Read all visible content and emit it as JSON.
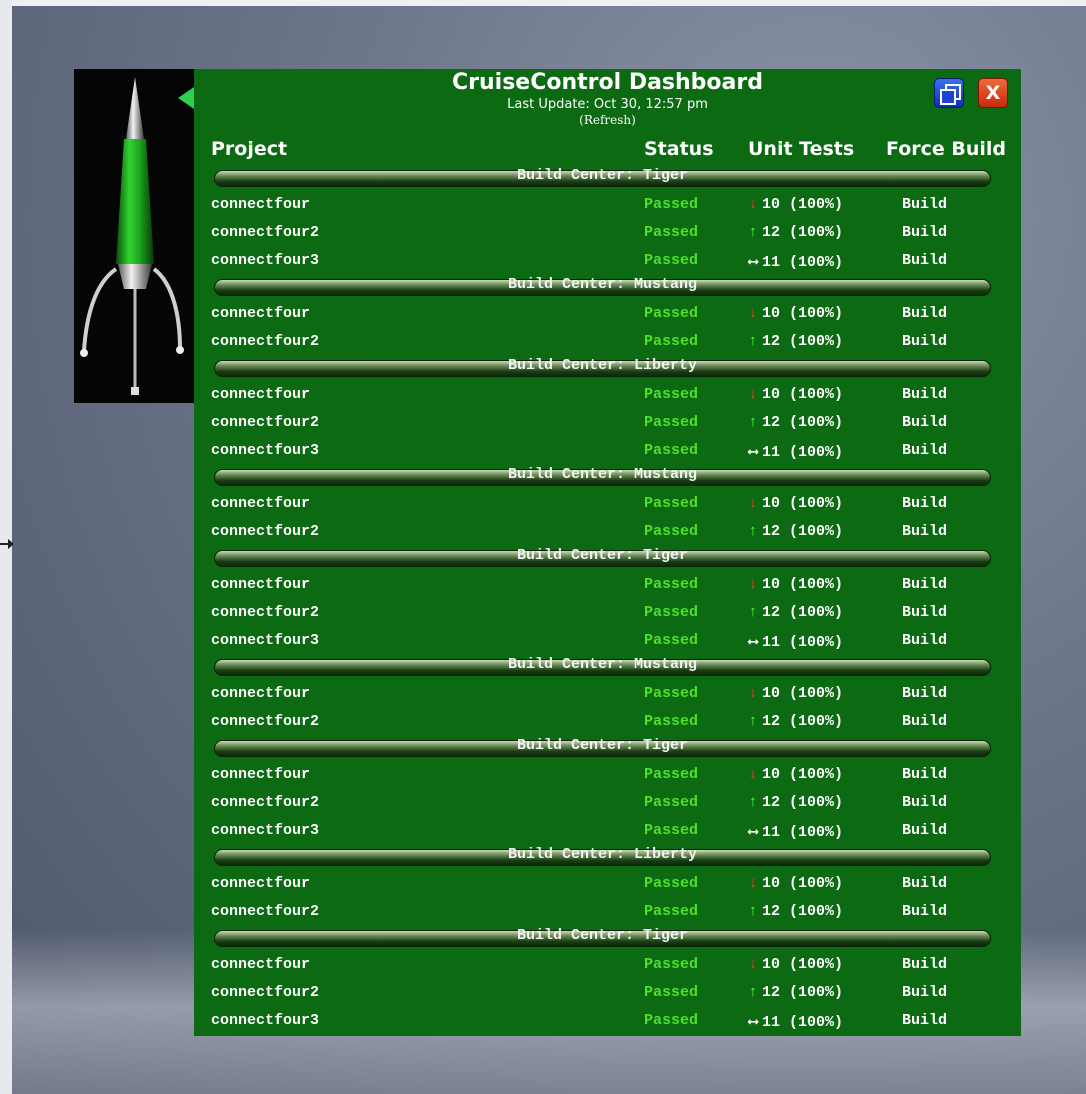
{
  "dashboard": {
    "title": "CruiseControl Dashboard",
    "last_update": "Last Update: Oct 30, 12:57 pm",
    "refresh": "(Refresh)",
    "close_label": "X",
    "headers": {
      "project": "Project",
      "status": "Status",
      "unit_tests": "Unit Tests",
      "force_build": "Force Build"
    },
    "colors": {
      "panel": "#0b6a12",
      "passed": "#4fe02a",
      "down": "#ff3a24",
      "up": "#49ff3a"
    }
  },
  "groups": [
    {
      "name": "Build Center: Tiger",
      "rows": [
        {
          "project": "connectfour",
          "status": "Passed",
          "trend": "down",
          "tests": "10 (100%)",
          "build": "Build"
        },
        {
          "project": "connectfour2",
          "status": "Passed",
          "trend": "up",
          "tests": "12 (100%)",
          "build": "Build"
        },
        {
          "project": "connectfour3",
          "status": "Passed",
          "trend": "flat",
          "tests": "11 (100%)",
          "build": "Build"
        }
      ]
    },
    {
      "name": "Build Center: Mustang",
      "rows": [
        {
          "project": "connectfour",
          "status": "Passed",
          "trend": "down",
          "tests": "10 (100%)",
          "build": "Build"
        },
        {
          "project": "connectfour2",
          "status": "Passed",
          "trend": "up",
          "tests": "12 (100%)",
          "build": "Build"
        }
      ]
    },
    {
      "name": "Build Center: Liberty",
      "rows": [
        {
          "project": "connectfour",
          "status": "Passed",
          "trend": "down",
          "tests": "10 (100%)",
          "build": "Build"
        },
        {
          "project": "connectfour2",
          "status": "Passed",
          "trend": "up",
          "tests": "12 (100%)",
          "build": "Build"
        },
        {
          "project": "connectfour3",
          "status": "Passed",
          "trend": "flat",
          "tests": "11 (100%)",
          "build": "Build"
        }
      ]
    },
    {
      "name": "Build Center: Mustang",
      "rows": [
        {
          "project": "connectfour",
          "status": "Passed",
          "trend": "down",
          "tests": "10 (100%)",
          "build": "Build"
        },
        {
          "project": "connectfour2",
          "status": "Passed",
          "trend": "up",
          "tests": "12 (100%)",
          "build": "Build"
        }
      ]
    },
    {
      "name": "Build Center: Tiger",
      "rows": [
        {
          "project": "connectfour",
          "status": "Passed",
          "trend": "down",
          "tests": "10 (100%)",
          "build": "Build"
        },
        {
          "project": "connectfour2",
          "status": "Passed",
          "trend": "up",
          "tests": "12 (100%)",
          "build": "Build"
        },
        {
          "project": "connectfour3",
          "status": "Passed",
          "trend": "flat",
          "tests": "11 (100%)",
          "build": "Build"
        }
      ]
    },
    {
      "name": "Build Center: Mustang",
      "rows": [
        {
          "project": "connectfour",
          "status": "Passed",
          "trend": "down",
          "tests": "10 (100%)",
          "build": "Build"
        },
        {
          "project": "connectfour2",
          "status": "Passed",
          "trend": "up",
          "tests": "12 (100%)",
          "build": "Build"
        }
      ]
    },
    {
      "name": "Build Center: Tiger",
      "rows": [
        {
          "project": "connectfour",
          "status": "Passed",
          "trend": "down",
          "tests": "10 (100%)",
          "build": "Build"
        },
        {
          "project": "connectfour2",
          "status": "Passed",
          "trend": "up",
          "tests": "12 (100%)",
          "build": "Build"
        },
        {
          "project": "connectfour3",
          "status": "Passed",
          "trend": "flat",
          "tests": "11 (100%)",
          "build": "Build"
        }
      ]
    },
    {
      "name": "Build Center: Liberty",
      "rows": [
        {
          "project": "connectfour",
          "status": "Passed",
          "trend": "down",
          "tests": "10 (100%)",
          "build": "Build"
        },
        {
          "project": "connectfour2",
          "status": "Passed",
          "trend": "up",
          "tests": "12 (100%)",
          "build": "Build"
        }
      ]
    },
    {
      "name": "Build Center: Tiger",
      "rows": [
        {
          "project": "connectfour",
          "status": "Passed",
          "trend": "down",
          "tests": "10 (100%)",
          "build": "Build"
        },
        {
          "project": "connectfour2",
          "status": "Passed",
          "trend": "up",
          "tests": "12 (100%)",
          "build": "Build"
        },
        {
          "project": "connectfour3",
          "status": "Passed",
          "trend": "flat",
          "tests": "11 (100%)",
          "build": "Build"
        }
      ]
    }
  ]
}
